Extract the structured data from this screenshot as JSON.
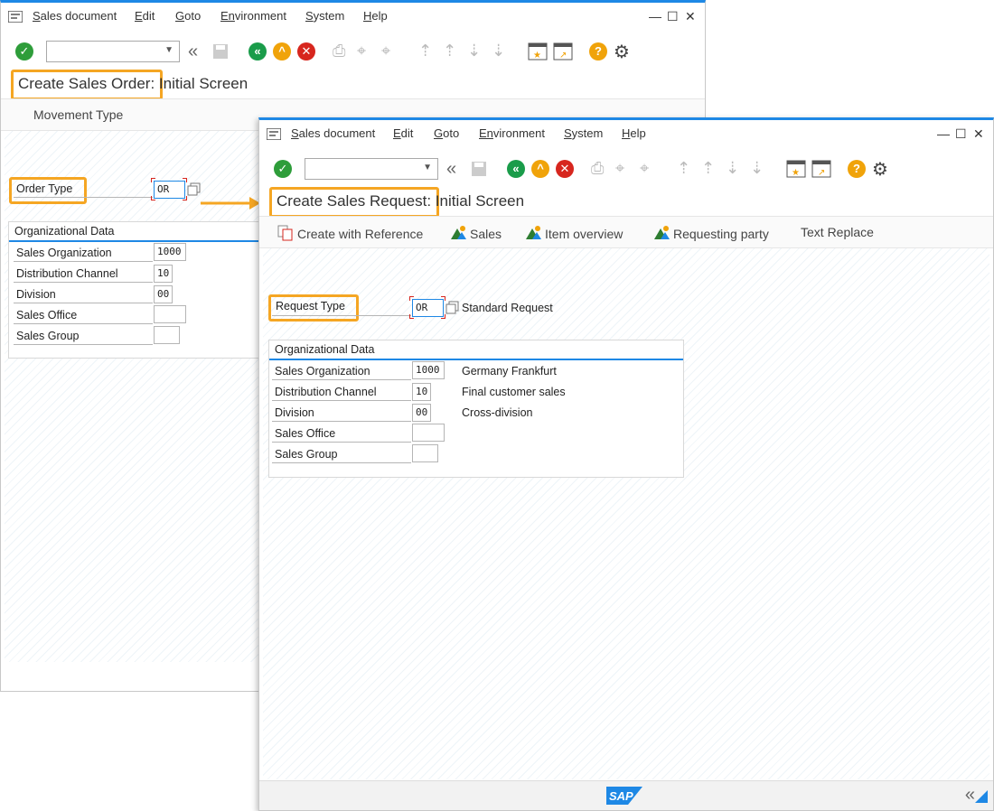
{
  "menu": {
    "items": [
      {
        "label": "Sales document",
        "u": "S",
        "rest": "ales document"
      },
      {
        "label": "Edit",
        "u": "E",
        "rest": "dit"
      },
      {
        "label": "Goto",
        "u": "G",
        "rest": "oto"
      },
      {
        "label": "Environment",
        "u": "En",
        "rest": "vironment"
      },
      {
        "label": "System",
        "u": "S",
        "rest": "ystem"
      },
      {
        "label": "Help",
        "u": "H",
        "rest": "elp"
      }
    ],
    "minimize": "—",
    "maximize": "☐",
    "close": "✕"
  },
  "back_window": {
    "title_highlight": "Create Sales Order:",
    "title_rest": "Initial Screen",
    "app_button": "Movement Type",
    "type_label": "Order Type",
    "type_value": "OR",
    "group_title": "Organizational Data",
    "fields": [
      {
        "label": "Sales Organization",
        "value": "1000"
      },
      {
        "label": "Distribution Channel",
        "value": "10"
      },
      {
        "label": "Division",
        "value": "00"
      },
      {
        "label": "Sales Office",
        "value": ""
      },
      {
        "label": "Sales Group",
        "value": ""
      }
    ]
  },
  "front_window": {
    "title_highlight": "Create Sales Request:",
    "title_rest": "Initial Screen",
    "app_buttons": [
      "Create with Reference",
      "Sales",
      "Item overview",
      "Requesting party",
      "Text Replace"
    ],
    "type_label": "Request Type",
    "type_value": "OR",
    "type_desc": "Standard Request",
    "group_title": "Organizational Data",
    "fields": [
      {
        "label": "Sales Organization",
        "value": "1000",
        "desc": "Germany Frankfurt"
      },
      {
        "label": "Distribution Channel",
        "value": "10",
        "desc": "Final customer sales"
      },
      {
        "label": "Division",
        "value": "00",
        "desc": "Cross-division"
      },
      {
        "label": "Sales Office",
        "value": "",
        "desc": ""
      },
      {
        "label": "Sales Group",
        "value": "",
        "desc": ""
      }
    ],
    "logo_text": "SAP"
  },
  "colors": {
    "highlight": "#f5a623",
    "accent": "#1e88e5",
    "enter_green": "#2e9d3a",
    "nav_green": "#1a9c4a",
    "up_yellow": "#f0a30a",
    "cancel_red": "#d7261e",
    "help": "#f0a30a"
  },
  "icons": [
    "menu-icon",
    "enter-icon",
    "back-icon",
    "exit-icon",
    "cancel-icon",
    "save-icon",
    "print-icon",
    "find-icon",
    "find-next-icon",
    "first-page-icon",
    "prev-page-icon",
    "next-page-icon",
    "last-page-icon",
    "new-session-icon",
    "shortcut-icon",
    "help-icon",
    "settings-icon",
    "create-reference-icon",
    "sales-icon",
    "item-overview-icon",
    "requesting-party-icon",
    "match-code-icon",
    "collapse-icon",
    "resize-icon"
  ]
}
